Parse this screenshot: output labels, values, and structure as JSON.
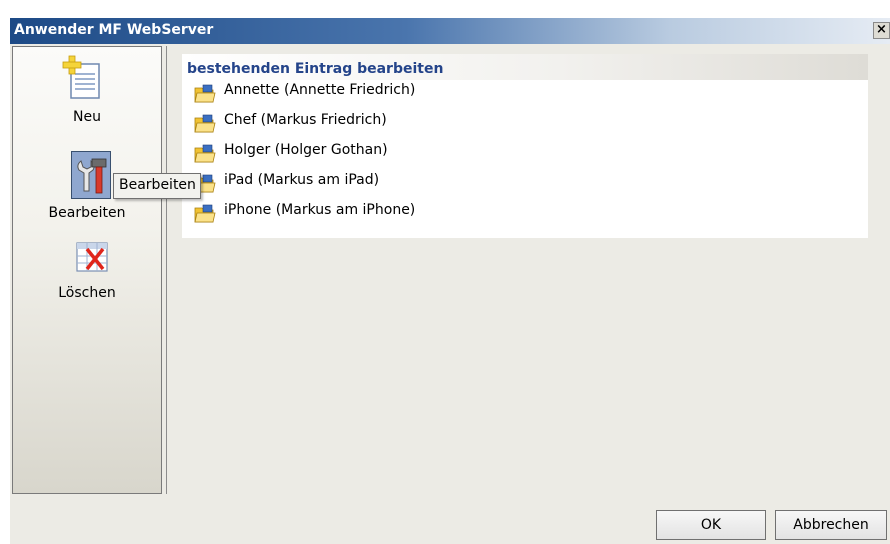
{
  "window": {
    "title": "Anwender MF WebServer",
    "close_glyph": "×"
  },
  "sidebar": {
    "items": [
      {
        "label": "Neu",
        "icon": "new-document-icon"
      },
      {
        "label": "Bearbeiten",
        "icon": "edit-tools-icon",
        "selected": true
      },
      {
        "label": "Löschen",
        "icon": "delete-table-icon"
      }
    ]
  },
  "tooltip": {
    "text": "Bearbeiten"
  },
  "list": {
    "header": "bestehenden Eintrag bearbeiten",
    "items": [
      {
        "label": "Annette (Annette Friedrich)",
        "icon": "folder-icon"
      },
      {
        "label": "Chef (Markus Friedrich)",
        "icon": "folder-icon"
      },
      {
        "label": "Holger (Holger Gothan)",
        "icon": "folder-icon"
      },
      {
        "label": "iPad (Markus am iPad)",
        "icon": "folder-icon"
      },
      {
        "label": "iPhone (Markus am iPhone)",
        "icon": "folder-icon"
      }
    ]
  },
  "buttons": {
    "ok": "OK",
    "cancel": "Abbrechen"
  },
  "colors": {
    "title_start": "#1d4a86",
    "header_text": "#24448a",
    "selection": "#8fa7cf"
  }
}
